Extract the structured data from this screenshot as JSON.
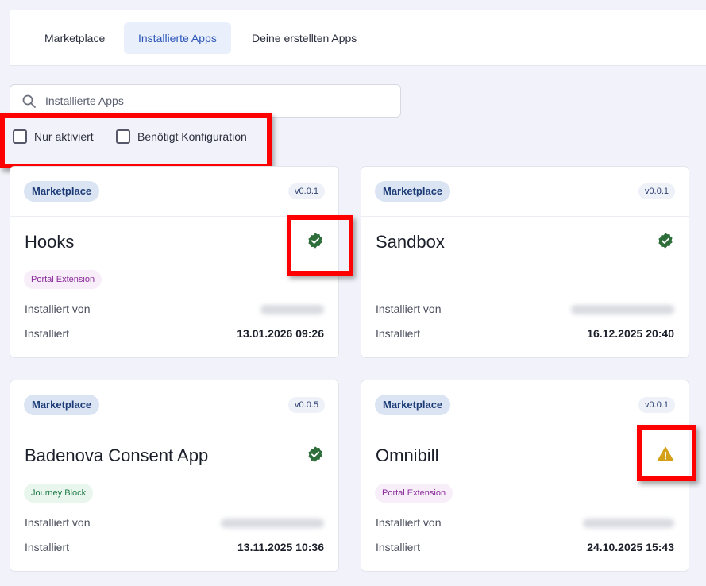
{
  "tabs": [
    {
      "label": "Marketplace",
      "active": false
    },
    {
      "label": "Installierte Apps",
      "active": true
    },
    {
      "label": "Deine erstellten Apps",
      "active": false
    }
  ],
  "search": {
    "placeholder": "Installierte Apps",
    "value": ""
  },
  "filters": [
    {
      "label": "Nur aktiviert",
      "checked": false
    },
    {
      "label": "Benötigt Konfiguration",
      "checked": false
    }
  ],
  "labels": {
    "installed_by": "Installiert von",
    "installed": "Installiert"
  },
  "apps": [
    {
      "source": "Marketplace",
      "version": "v0.0.1",
      "name": "Hooks",
      "status": "check-icon",
      "type": "Portal Extension",
      "installed_by": "",
      "installed_at": "13.01.2026 09:26"
    },
    {
      "source": "Marketplace",
      "version": "v0.0.1",
      "name": "Sandbox",
      "status": "check-icon",
      "type": "",
      "installed_by": "",
      "installed_at": "16.12.2025 20:40"
    },
    {
      "source": "Marketplace",
      "version": "v0.0.5",
      "name": "Badenova Consent App",
      "status": "check-icon",
      "type": "Journey Block",
      "installed_by": "",
      "installed_at": "13.11.2025 10:36"
    },
    {
      "source": "Marketplace",
      "version": "v0.0.1",
      "name": "Omnibill",
      "status": "warning-icon",
      "type": "Portal Extension",
      "installed_by": "",
      "installed_at": "24.10.2025 15:43"
    }
  ],
  "colors": {
    "accent": "#2d56b8",
    "success": "#2e6e3a",
    "warning": "#d4a017",
    "highlight": "#ff0000"
  }
}
